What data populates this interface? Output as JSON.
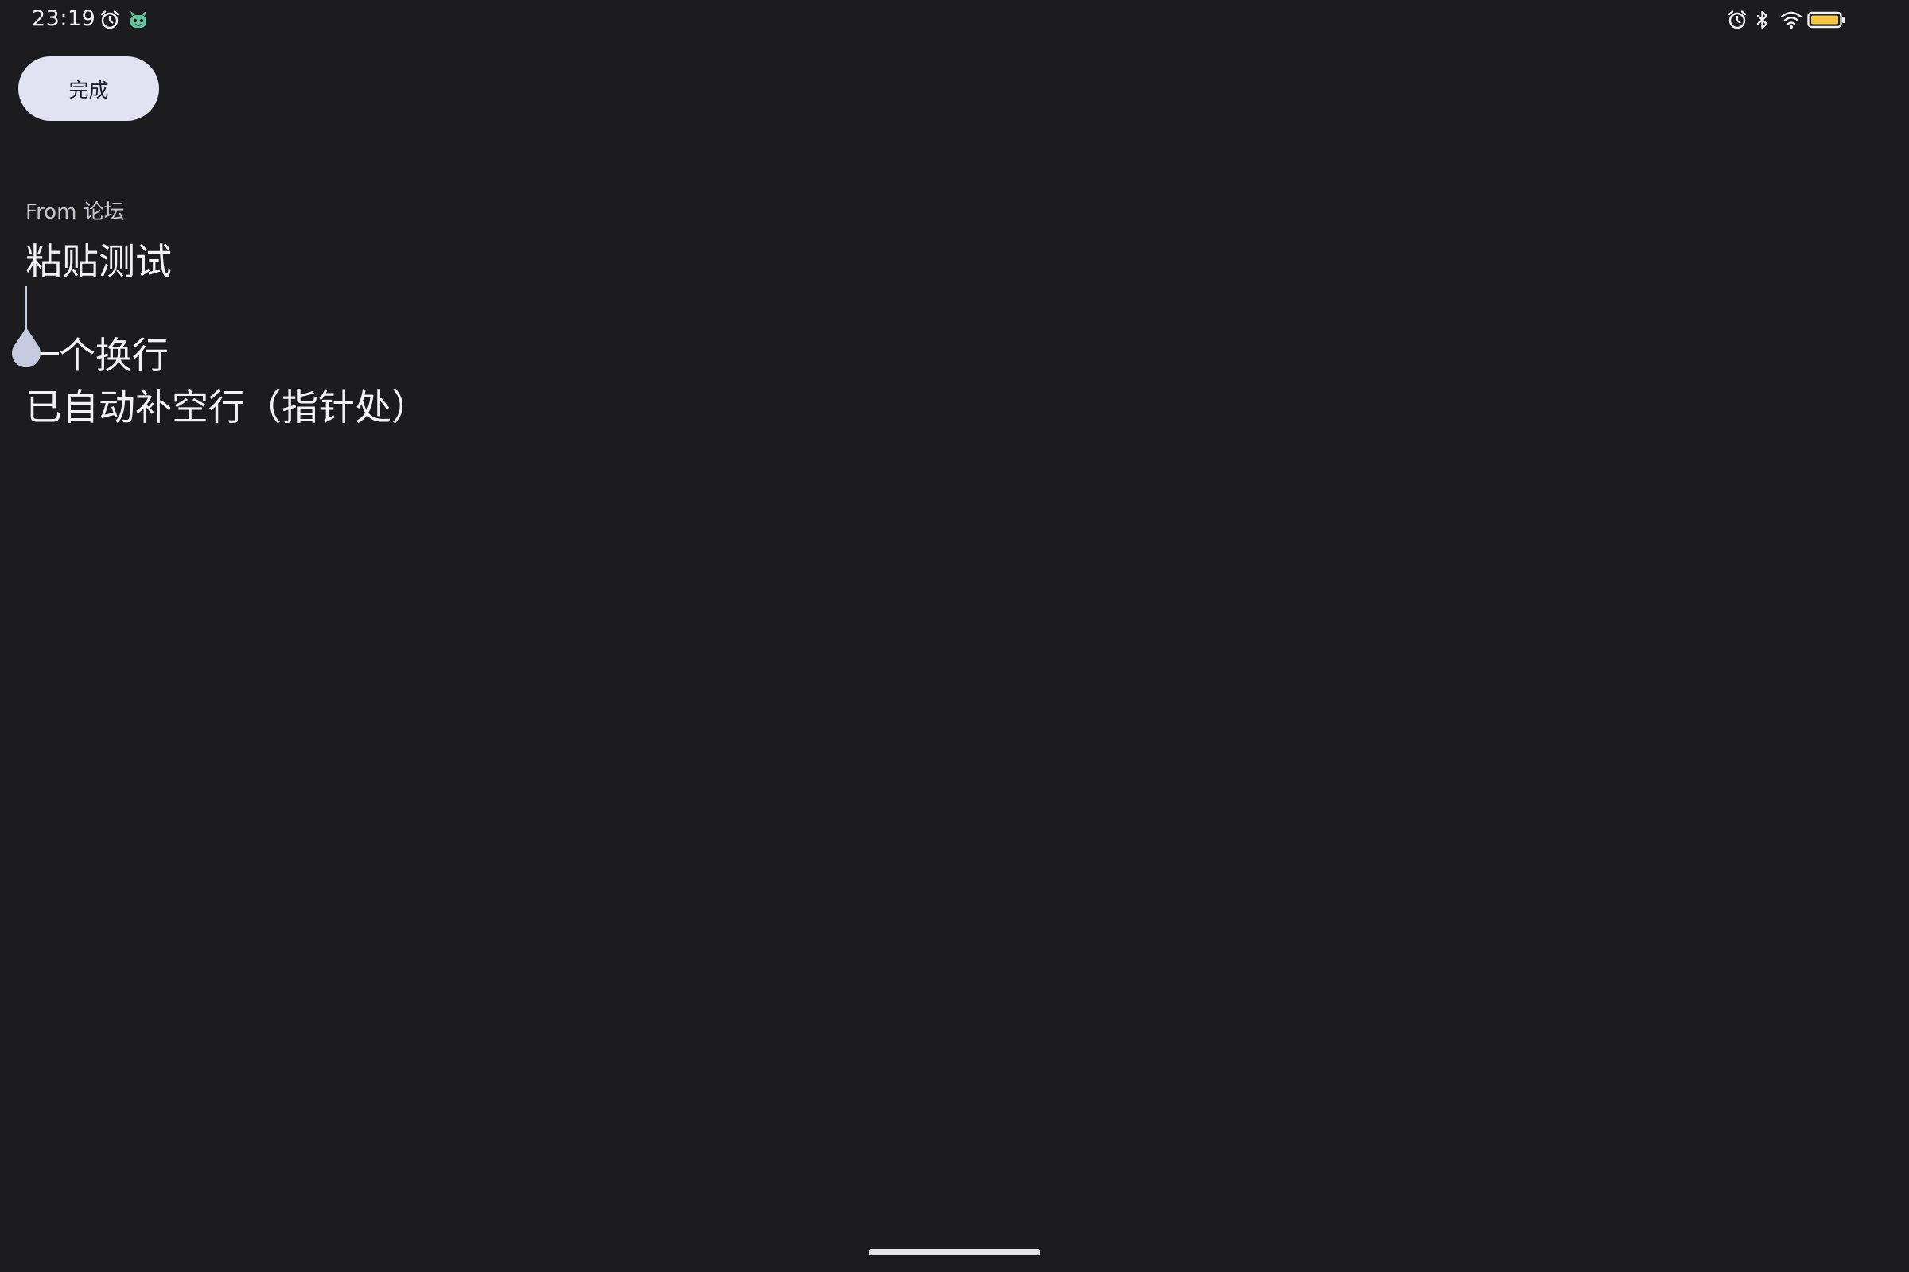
{
  "status_bar": {
    "time": "23:19",
    "left_icons": [
      "alarm-icon",
      "app-mascot-icon"
    ],
    "right_icons": [
      "alarm-icon",
      "bluetooth-icon",
      "wifi-icon",
      "battery-icon"
    ],
    "battery_color": "#f5c542"
  },
  "toolbar": {
    "done_label": "完成"
  },
  "note": {
    "source": "From 论坛",
    "lines": [
      "粘贴测试",
      "",
      "个换行",
      "已自动补空行（指针处）"
    ]
  },
  "colors": {
    "background": "#1c1c1e",
    "button_bg": "#e1e3f3",
    "cursor": "#c7cbe2",
    "text": "#f2f2f4"
  }
}
